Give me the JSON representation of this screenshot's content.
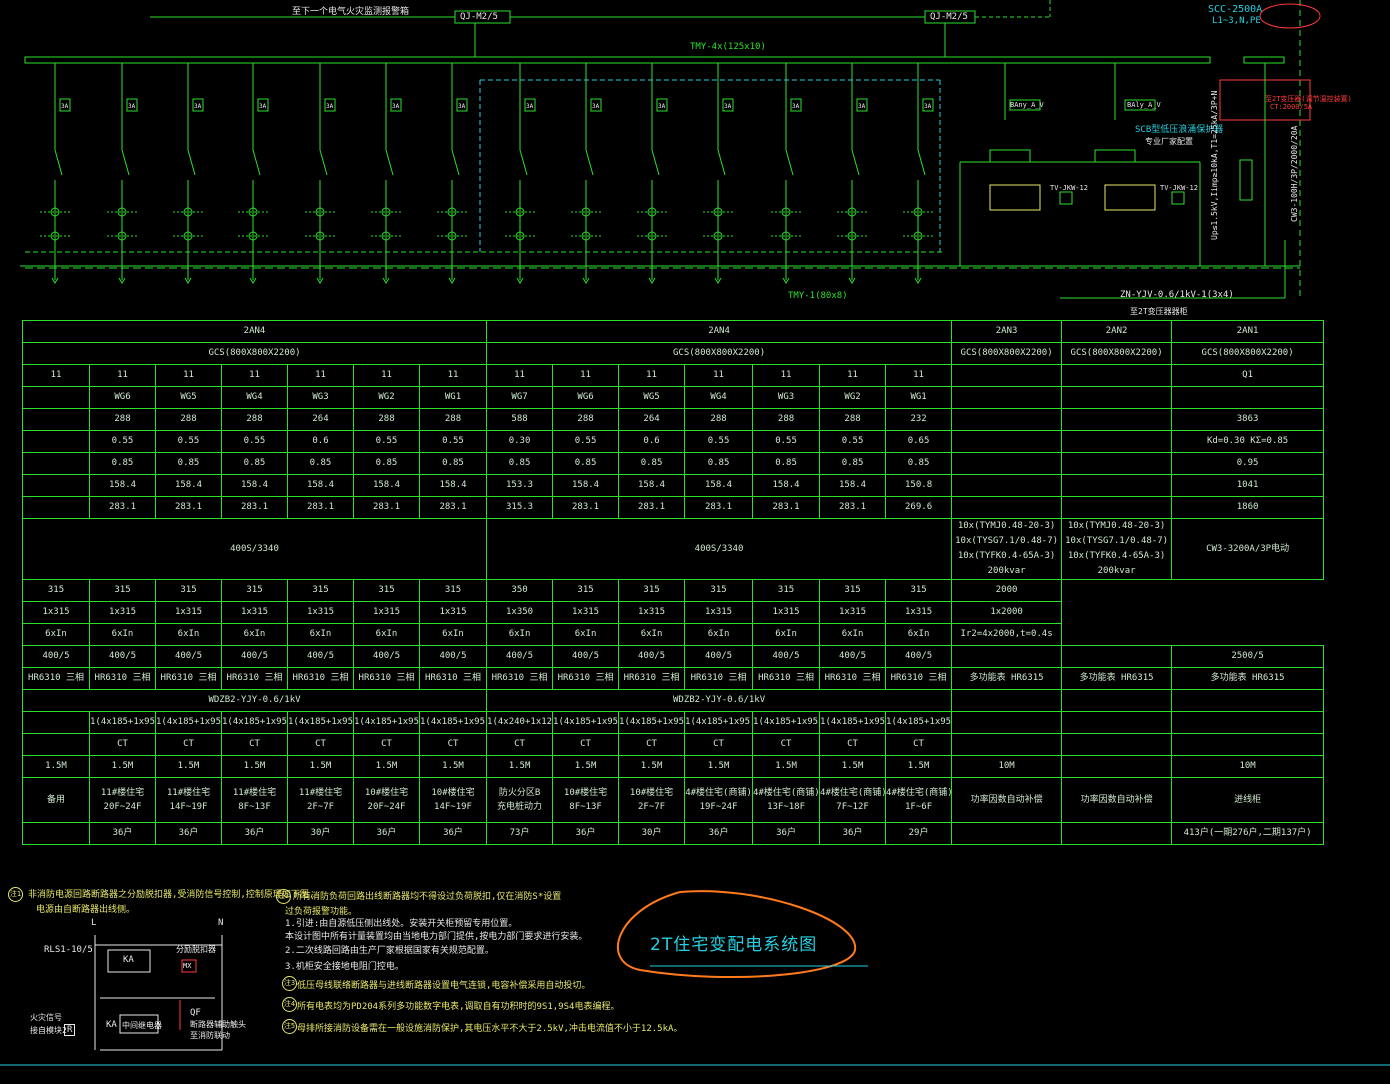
{
  "top": {
    "left_note": "至下一个电气火灾监测报警箱",
    "qj_1": "QJ-M2/5",
    "qj_2": "QJ-M2/5",
    "busbar": "TMY-4x(125x10)",
    "scc": "SCC-2500A",
    "scc_sub": "L1~3,N,PE",
    "tmy_bottom": "TMY-1(80x8)",
    "zn_cable": "ZN-YJV-0.6/1kV-1(3x4)",
    "to_transformer": "至2T变压器器柜",
    "scb": "SCB型低压浪涌保护器",
    "maker": "专业厂家配置",
    "rotated_1": "Up≤1.5kV,Iimp≥10kA,T1=25kA/3P+N",
    "rotated_2": "CW3-100H/3P/2000/20A",
    "red_1": "至2T变压器(调节温控装置)",
    "red_2": "CT:2000/5A",
    "cap_1": "BAny_A_V",
    "cap_2": "BAly_A_V",
    "tv_1": "TV-JKW-12",
    "tv_2": "TV-JKW-12",
    "fuse_tag": "3A"
  },
  "schedule": {
    "panels": [
      {
        "name": "2AN4",
        "type": "GCS(800X800X2200)"
      },
      {
        "name": "2AN4",
        "type": "GCS(800X800X2200)"
      },
      {
        "name": "2AN3",
        "type": "GCS(800X800X2200)"
      },
      {
        "name": "2AN2",
        "type": "GCS(800X800X2200)"
      },
      {
        "name": "2AN1",
        "type": "GCS(800X800X2200)"
      }
    ],
    "row1": [
      "11",
      "11",
      "11",
      "11",
      "11",
      "11",
      "11",
      "11",
      "11",
      "11",
      "11",
      "11",
      "11",
      "11",
      "",
      "",
      "Q1"
    ],
    "row2": [
      "",
      "WG6",
      "WG5",
      "WG4",
      "WG3",
      "WG2",
      "WG1",
      "WG7",
      "WG6",
      "WG5",
      "WG4",
      "WG3",
      "WG2",
      "WG1",
      "",
      "",
      ""
    ],
    "row3": [
      "",
      "288",
      "288",
      "288",
      "264",
      "288",
      "288",
      "588",
      "288",
      "264",
      "288",
      "288",
      "288",
      "232",
      "",
      "",
      "3863"
    ],
    "row4": [
      "",
      "0.55",
      "0.55",
      "0.55",
      "0.6",
      "0.55",
      "0.55",
      "0.30",
      "0.55",
      "0.6",
      "0.55",
      "0.55",
      "0.55",
      "0.65",
      "",
      "",
      "Kd=0.30   KΣ=0.85"
    ],
    "row5": [
      "",
      "0.85",
      "0.85",
      "0.85",
      "0.85",
      "0.85",
      "0.85",
      "0.85",
      "0.85",
      "0.85",
      "0.85",
      "0.85",
      "0.85",
      "0.85",
      "",
      "",
      "0.95"
    ],
    "row6": [
      "",
      "158.4",
      "158.4",
      "158.4",
      "158.4",
      "158.4",
      "158.4",
      "153.3",
      "158.4",
      "158.4",
      "158.4",
      "158.4",
      "158.4",
      "150.8",
      "",
      "",
      "1041"
    ],
    "row7": [
      "",
      "283.1",
      "283.1",
      "283.1",
      "283.1",
      "283.1",
      "283.1",
      "315.3",
      "283.1",
      "283.1",
      "283.1",
      "283.1",
      "283.1",
      "269.6",
      "",
      "",
      "1860"
    ],
    "breaker_left": "400S/3340",
    "breaker_right": "400S/3340",
    "cap_a": [
      "10x(TYMJ0.48-20-3)",
      "10x(TYSG7.1/0.48-7)",
      "10x(TYFK0.4-65A-3)",
      "200kvar"
    ],
    "cap_b": [
      "10x(TYMJ0.48-20-3)",
      "10x(TYSG7.1/0.48-7)",
      "10x(TYFK0.4-65A-3)",
      "200kvar"
    ],
    "main_breaker": "CW3-3200A/3P电动",
    "row9": [
      "315",
      "315",
      "315",
      "315",
      "315",
      "315",
      "315",
      "350",
      "315",
      "315",
      "315",
      "315",
      "315",
      "315",
      "",
      "",
      "2000"
    ],
    "row10": [
      "1x315",
      "1x315",
      "1x315",
      "1x315",
      "1x315",
      "1x315",
      "1x315",
      "1x350",
      "1x315",
      "1x315",
      "1x315",
      "1x315",
      "1x315",
      "1x315",
      "",
      "",
      "1x2000"
    ],
    "row11": [
      "6xIn",
      "6xIn",
      "6xIn",
      "6xIn",
      "6xIn",
      "6xIn",
      "6xIn",
      "6xIn",
      "6xIn",
      "6xIn",
      "6xIn",
      "6xIn",
      "6xIn",
      "6xIn",
      "",
      "",
      "Ir2=4x2000,t=0.4s"
    ],
    "row12": [
      "400/5",
      "400/5",
      "400/5",
      "400/5",
      "400/5",
      "400/5",
      "400/5",
      "400/5",
      "400/5",
      "400/5",
      "400/5",
      "400/5",
      "400/5",
      "400/5",
      "",
      "",
      "2500/5"
    ],
    "row13": [
      "HR6310  三相",
      "HR6310  三相",
      "HR6310  三相",
      "HR6310  三相",
      "HR6310  三相",
      "HR6310  三相",
      "HR6310  三相",
      "HR6310  三相",
      "HR6310  三相",
      "HR6310  三相",
      "HR6310  三相",
      "HR6310  三相",
      "HR6310  三相",
      "HR6310  三相",
      "多功能表   HR6315",
      "多功能表   HR6315",
      "多功能表      HR6315"
    ],
    "cable_left": "WDZB2-YJY-0.6/1kV",
    "cable_right": "WDZB2-YJY-0.6/1kV",
    "row15": [
      "",
      "1(4x185+1x95)",
      "1(4x185+1x95)",
      "1(4x185+1x95)",
      "1(4x185+1x95)",
      "1(4x185+1x95)",
      "1(4x185+1x95)",
      "1(4x240+1x120)",
      "1(4x185+1x95)",
      "1(4x185+1x95)",
      "1(4x185+1x95)",
      "1(4x185+1x95)",
      "1(4x185+1x95)",
      "1(4x185+1x95)",
      "",
      "",
      ""
    ],
    "row16": [
      "",
      "CT",
      "CT",
      "CT",
      "CT",
      "CT",
      "CT",
      "CT",
      "CT",
      "CT",
      "CT",
      "CT",
      "CT",
      "CT",
      "",
      "",
      ""
    ],
    "row17": [
      "1.5M",
      "1.5M",
      "1.5M",
      "1.5M",
      "1.5M",
      "1.5M",
      "1.5M",
      "1.5M",
      "1.5M",
      "1.5M",
      "1.5M",
      "1.5M",
      "1.5M",
      "1.5M",
      "10M",
      "",
      "10M"
    ],
    "row18": [
      [
        "备用",
        ""
      ],
      [
        "11#楼住宅",
        "20F~24F"
      ],
      [
        "11#楼住宅",
        "14F~19F"
      ],
      [
        "11#楼住宅",
        "8F~13F"
      ],
      [
        "11#楼住宅",
        "2F~7F"
      ],
      [
        "10#楼住宅",
        "20F~24F"
      ],
      [
        "10#楼住宅",
        "14F~19F"
      ],
      [
        "防火分区B",
        "充电桩动力"
      ],
      [
        "10#楼住宅",
        "8F~13F"
      ],
      [
        "10#楼住宅",
        "2F~7F"
      ],
      [
        "4#楼住宅(商铺)",
        "19F~24F"
      ],
      [
        "4#楼住宅(商铺)",
        "13F~18F"
      ],
      [
        "4#楼住宅(商铺)",
        "7F~12F"
      ],
      [
        "4#楼住宅(商铺)",
        "1F~6F"
      ],
      [
        "功率因数自动补偿",
        ""
      ],
      [
        "功率因数自动补偿",
        ""
      ],
      [
        "进线柜",
        ""
      ]
    ],
    "row19": [
      "",
      "36户",
      "36户",
      "36户",
      "30户",
      "36户",
      "36户",
      "73户",
      "36户",
      "30户",
      "36户",
      "36户",
      "36户",
      "29户",
      "",
      "",
      "413户(一期276户,二期137户)"
    ]
  },
  "notes": {
    "n1": "非消防电源回路断路器之分励脱扣器,受消防信号控制,控制原理如下图,",
    "n1b": "电源由自断路器出线侧。",
    "n2": "所有消防负荷回路出线断路器均不得设过负荷脱扣,仅在消防S*设置",
    "n2b": "过负荷报警功能。",
    "n2c": "1.引进:由自源低压侧出线处。安装开关柜预留专用位置。",
    "n2d": "本设计图中所有计量装置均由当地电力部门提供,按电力部门要求进行安装。",
    "n2e": "2.二次线路回路由生产厂家根据国家有关规范配置。",
    "n2f": "3.机柜安全接地电阻门控电。",
    "n3": "低压母线联络断路器与进线断路器设置电气连锁,电容补偿采用自动投切。",
    "n4": "所有电表均为PD204系列多功能数字电表,调取自有功积时的9S1,9S4电表编程。",
    "n5": "母排所接消防设备需在一般设施消防保护,其电压水平不大于2.5kV,冲击电流值不小于12.5kA。",
    "circ_1": "注1",
    "circ_2": "注2",
    "circ_3": "注3",
    "circ_4": "注4",
    "circ_5": "注5"
  },
  "control": {
    "L": "L",
    "N": "N",
    "rls": "RLS1-10/5",
    "ka": "KA",
    "ka2": "KA",
    "mx": "MX",
    "shunt": "分励脱扣器",
    "relay": "中间继电器",
    "qf": "QF",
    "qf_desc1": "断路器辅助触头",
    "qf_desc2": "至消防联动",
    "fire_1": "火灾信号",
    "fire_2": "接自模块2",
    "fire_r": "R"
  },
  "annotation": "2T住宅变配电系统图"
}
